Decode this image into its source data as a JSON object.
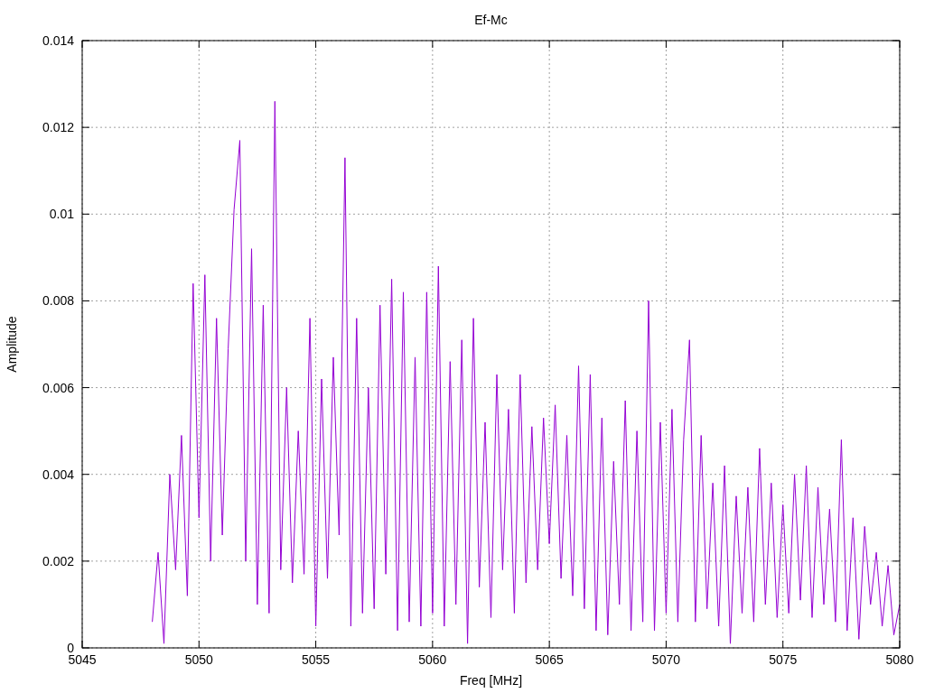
{
  "chart_data": {
    "type": "line",
    "title": "Ef-Mc",
    "xlabel": "Freq [MHz]",
    "ylabel": "Amplitude",
    "grid": true,
    "xlim": [
      5045,
      5080
    ],
    "ylim": [
      0,
      0.014
    ],
    "xticks": [
      5045,
      5050,
      5055,
      5060,
      5065,
      5070,
      5075,
      5080
    ],
    "yticks": [
      0,
      0.002,
      0.004,
      0.006,
      0.008,
      0.01,
      0.012,
      0.014
    ],
    "x": [
      5048,
      5048.25,
      5048.5,
      5048.75,
      5049,
      5049.25,
      5049.5,
      5049.75,
      5050,
      5050.25,
      5050.5,
      5050.75,
      5051,
      5051.25,
      5051.5,
      5051.75,
      5052,
      5052.25,
      5052.5,
      5052.75,
      5053,
      5053.25,
      5053.5,
      5053.75,
      5054,
      5054.25,
      5054.5,
      5054.75,
      5055,
      5055.25,
      5055.5,
      5055.75,
      5056,
      5056.25,
      5056.5,
      5056.75,
      5057,
      5057.25,
      5057.5,
      5057.75,
      5058,
      5058.25,
      5058.5,
      5058.75,
      5059,
      5059.25,
      5059.5,
      5059.75,
      5060,
      5060.25,
      5060.5,
      5060.75,
      5061,
      5061.25,
      5061.5,
      5061.75,
      5062,
      5062.25,
      5062.5,
      5062.75,
      5063,
      5063.25,
      5063.5,
      5063.75,
      5064,
      5064.25,
      5064.5,
      5064.75,
      5065,
      5065.25,
      5065.5,
      5065.75,
      5066,
      5066.25,
      5066.5,
      5066.75,
      5067,
      5067.25,
      5067.5,
      5067.75,
      5068,
      5068.25,
      5068.5,
      5068.75,
      5069,
      5069.25,
      5069.5,
      5069.75,
      5070,
      5070.25,
      5070.5,
      5070.75,
      5071,
      5071.25,
      5071.5,
      5071.75,
      5072,
      5072.25,
      5072.5,
      5072.75,
      5073,
      5073.25,
      5073.5,
      5073.75,
      5074,
      5074.25,
      5074.5,
      5074.75,
      5075,
      5075.25,
      5075.5,
      5075.75,
      5076,
      5076.25,
      5076.5,
      5076.75,
      5077,
      5077.25,
      5077.5,
      5077.75,
      5078,
      5078.25,
      5078.5,
      5078.75,
      5079,
      5079.25,
      5079.5,
      5079.75,
      5080
    ],
    "series": [
      {
        "color": "#9400d3",
        "values": [
          0.0006,
          0.0022,
          0.0001,
          0.004,
          0.0018,
          0.0049,
          0.0012,
          0.0084,
          0.003,
          0.0086,
          0.002,
          0.0076,
          0.0026,
          0.0069,
          0.0101,
          0.0117,
          0.002,
          0.0092,
          0.001,
          0.0079,
          0.0008,
          0.0126,
          0.0018,
          0.006,
          0.0015,
          0.005,
          0.0017,
          0.0076,
          0.0005,
          0.0062,
          0.0016,
          0.0067,
          0.0026,
          0.0113,
          0.0005,
          0.0076,
          0.0008,
          0.006,
          0.0009,
          0.0079,
          0.0017,
          0.0085,
          0.0004,
          0.0082,
          0.0006,
          0.0067,
          0.0005,
          0.0082,
          0.0008,
          0.0088,
          0.0005,
          0.0066,
          0.001,
          0.0071,
          0.0001,
          0.0076,
          0.0014,
          0.0052,
          0.0007,
          0.0063,
          0.0018,
          0.0055,
          0.0008,
          0.0063,
          0.0015,
          0.0051,
          0.0018,
          0.0053,
          0.0024,
          0.0056,
          0.0016,
          0.0049,
          0.0012,
          0.0065,
          0.0009,
          0.0063,
          0.0004,
          0.0053,
          0.0003,
          0.0043,
          0.001,
          0.0057,
          0.0004,
          0.005,
          0.0006,
          0.008,
          0.0004,
          0.0052,
          0.0008,
          0.0055,
          0.0006,
          0.0048,
          0.0071,
          0.0006,
          0.0049,
          0.0009,
          0.0038,
          0.0005,
          0.0042,
          0.0001,
          0.0035,
          0.0008,
          0.0037,
          0.0006,
          0.0046,
          0.001,
          0.0038,
          0.0007,
          0.0033,
          0.0008,
          0.004,
          0.0011,
          0.0042,
          0.0007,
          0.0037,
          0.001,
          0.0032,
          0.0006,
          0.0048,
          0.0004,
          0.003,
          0.0002,
          0.0028,
          0.001,
          0.0022,
          0.0005,
          0.0019,
          0.0003,
          0.001
        ]
      }
    ]
  }
}
